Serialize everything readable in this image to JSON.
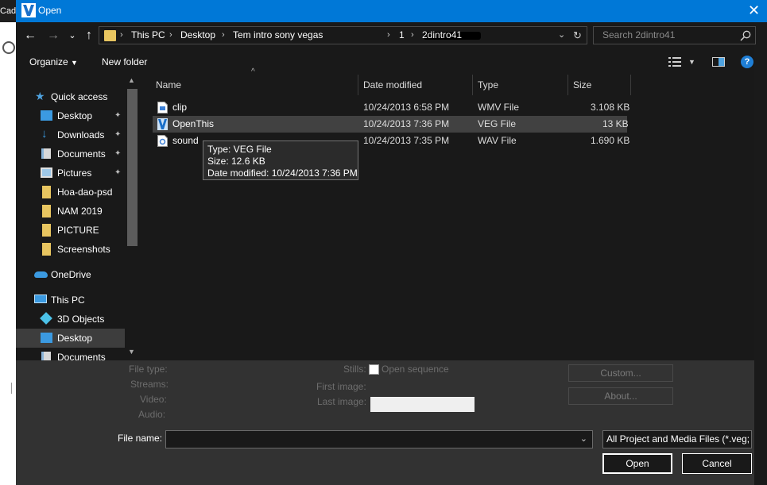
{
  "background_app": {
    "fragment_text": "Cad"
  },
  "window": {
    "title": "Open",
    "close_glyph": "✕"
  },
  "nav": {
    "back": "←",
    "forward": "→",
    "recent": "⌄",
    "up": "↑"
  },
  "address": {
    "crumbs": [
      "This PC",
      "Desktop",
      "Tem intro sony vegas",
      "1",
      "2dintro41"
    ],
    "separator": "›"
  },
  "search": {
    "placeholder": "Search 2dintro41"
  },
  "toolbar": {
    "organize": "Organize",
    "new_folder": "New folder",
    "help": "?"
  },
  "sidebar": {
    "items": [
      {
        "label": "Quick access",
        "icon": "star-icon",
        "pinned": false
      },
      {
        "label": "Desktop",
        "icon": "desktop-folder-icon",
        "pinned": true
      },
      {
        "label": "Downloads",
        "icon": "download-arrow-icon",
        "pinned": true
      },
      {
        "label": "Documents",
        "icon": "documents-icon",
        "pinned": true
      },
      {
        "label": "Pictures",
        "icon": "pictures-icon",
        "pinned": true
      },
      {
        "label": "Hoa-dao-psd",
        "icon": "folder-icon",
        "pinned": false
      },
      {
        "label": "NAM 2019",
        "icon": "folder-icon",
        "pinned": false
      },
      {
        "label": "PICTURE",
        "icon": "folder-icon",
        "pinned": false
      },
      {
        "label": "Screenshots",
        "icon": "folder-icon",
        "pinned": false
      },
      {
        "label": "OneDrive",
        "icon": "cloud-icon",
        "pinned": false
      },
      {
        "label": "This PC",
        "icon": "computer-icon",
        "pinned": false
      },
      {
        "label": "3D Objects",
        "icon": "cube-icon",
        "pinned": false
      },
      {
        "label": "Desktop",
        "icon": "desktop-folder-icon",
        "pinned": false,
        "selected": true
      },
      {
        "label": "Documents",
        "icon": "documents-icon",
        "pinned": false
      }
    ],
    "pin_glyph": "📌"
  },
  "columns": [
    "Name",
    "Date modified",
    "Type",
    "Size"
  ],
  "files": [
    {
      "name": "clip",
      "date": "10/24/2013 6:58 PM",
      "type": "WMV File",
      "size": "3.108 KB",
      "icon": "video-file-icon"
    },
    {
      "name": "OpenThis",
      "date": "10/24/2013 7:36 PM",
      "type": "VEG File",
      "size": "13 KB",
      "icon": "vegas-project-icon",
      "selected": true
    },
    {
      "name": "sound",
      "date": "10/24/2013 7:35 PM",
      "type": "WAV File",
      "size": "1.690 KB",
      "icon": "audio-file-icon"
    }
  ],
  "tooltip": {
    "lines": [
      "Type: VEG File",
      "Size: 12.6 KB",
      "Date modified: 10/24/2013 7:36 PM"
    ]
  },
  "preview_panel": {
    "file_type": "File type:",
    "streams": "Streams:",
    "video": "Video:",
    "audio": "Audio:",
    "stills": "Stills:",
    "open_sequence": "Open sequence",
    "first_image": "First image:",
    "last_image": "Last image:",
    "custom_button": "Custom...",
    "about_button": "About..."
  },
  "footer": {
    "file_name_label": "File name:",
    "file_name_value": "",
    "file_type_filter": "All Project and Media Files (*.veg;",
    "open_button": "Open",
    "cancel_button": "Cancel"
  }
}
